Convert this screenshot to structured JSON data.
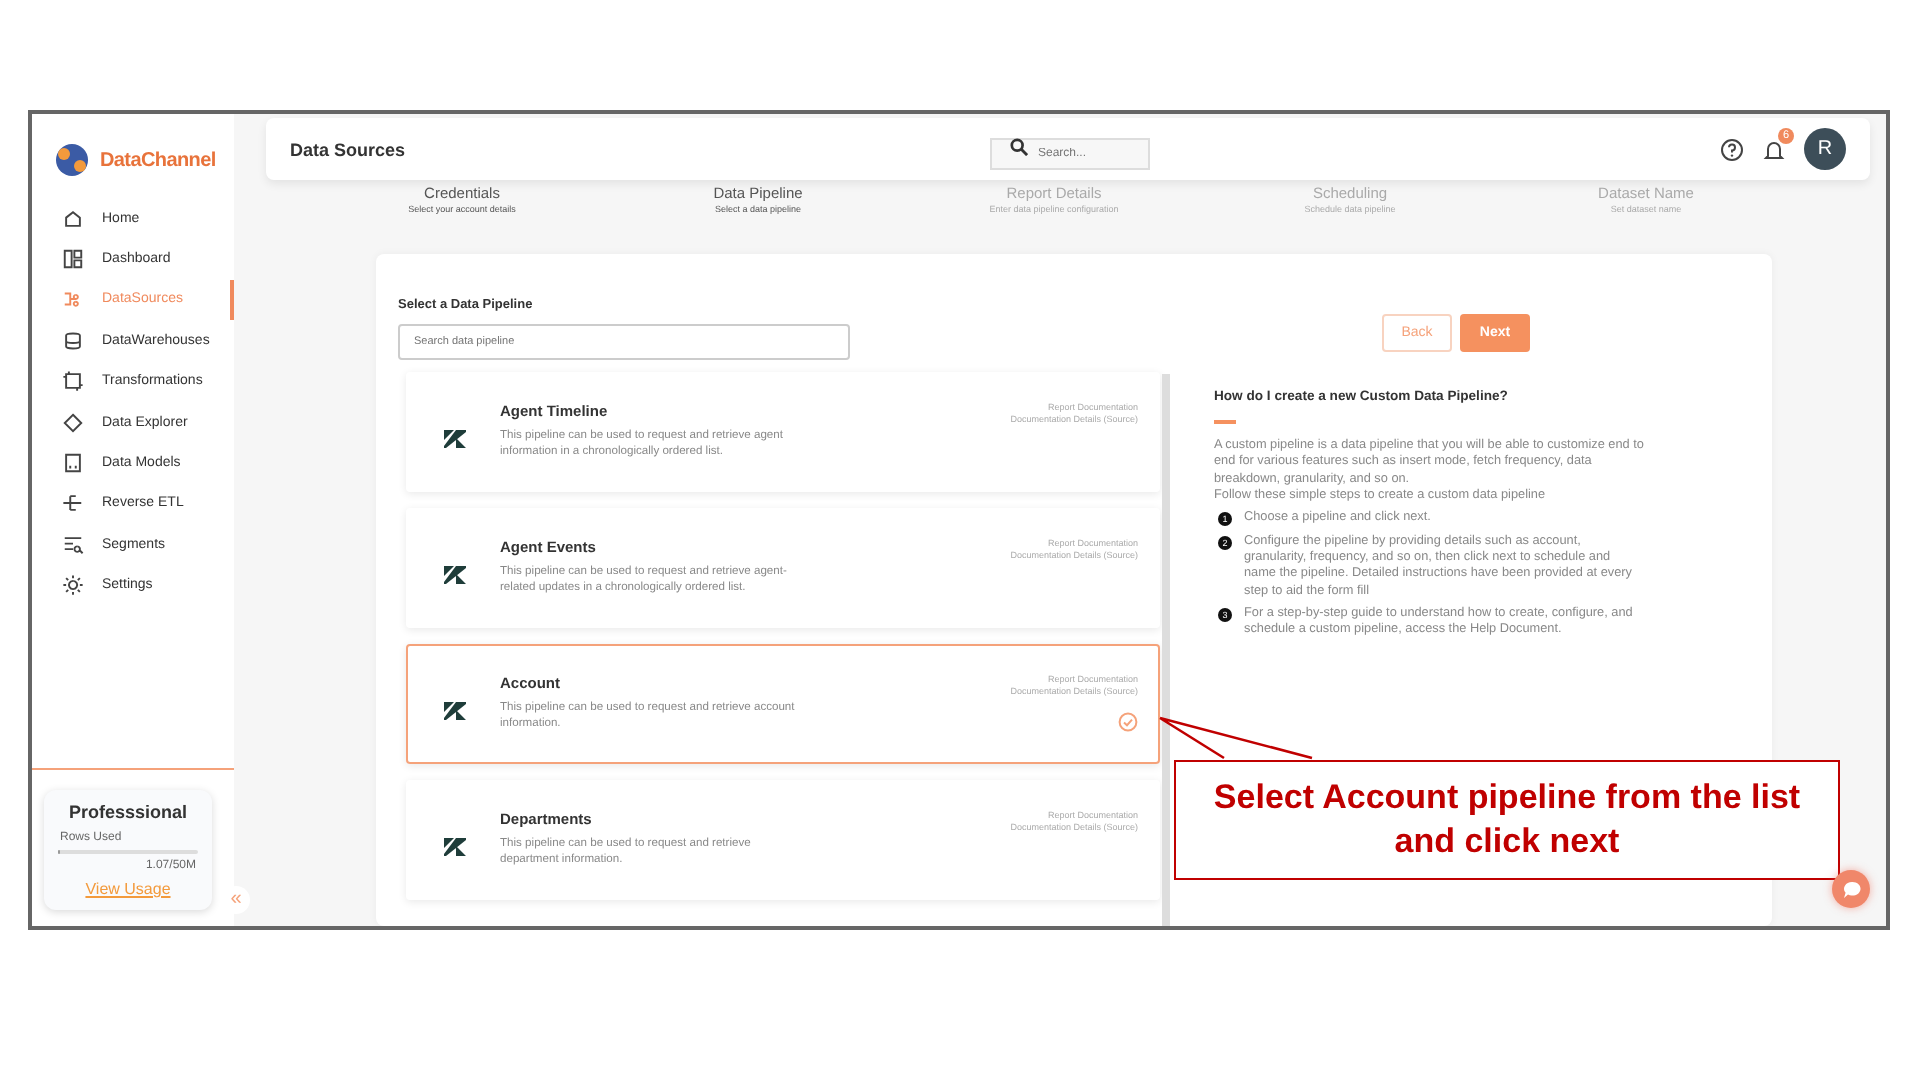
{
  "sidebar": {
    "brand": "DataChannel",
    "items": [
      {
        "label": "Home",
        "selected": false
      },
      {
        "label": "Dashboard",
        "selected": false
      },
      {
        "label": "DataSources",
        "selected": true
      },
      {
        "label": "DataWarehouses",
        "selected": false
      },
      {
        "label": "Transformations",
        "selected": false
      },
      {
        "label": "Data Explorer",
        "selected": false
      },
      {
        "label": "Data Models",
        "selected": false
      },
      {
        "label": "Reverse ETL",
        "selected": false
      },
      {
        "label": "Segments",
        "selected": false
      },
      {
        "label": "Settings",
        "selected": false
      }
    ],
    "plan": {
      "name": "Professsional",
      "usage_label": "Rows Used",
      "level": 0.02,
      "usage": "1.07/50M",
      "link": "View Usage"
    },
    "collapse": "«"
  },
  "header": {
    "title": "Data Sources",
    "search": {
      "placeholder": "Search..."
    },
    "notifications": "6",
    "avatar": "R"
  },
  "steps": [
    {
      "label": "Credentials",
      "sub": "Select your account details",
      "active": true
    },
    {
      "label": "Data Pipeline",
      "sub": "Select a data pipeline",
      "active": true
    },
    {
      "label": "Report Details",
      "sub": "Enter data pipeline configuration",
      "active": false
    },
    {
      "label": "Scheduling",
      "sub": "Schedule data pipeline",
      "active": false
    },
    {
      "label": "Dataset Name",
      "sub": "Set dataset name",
      "active": false
    }
  ],
  "picker": {
    "label": "Select a Data Pipeline",
    "search": {
      "placeholder": "Search data pipeline"
    },
    "back": "Back",
    "next": "Next"
  },
  "pipelines": [
    {
      "name": "Agent Timeline",
      "description": "This pipeline can be used to request and retrieve agent information in a chronologically ordered list.",
      "links": [
        "Report Documentation",
        "Documentation Details (Source)"
      ],
      "selected": false
    },
    {
      "name": "Agent Events",
      "description": "This pipeline can be used to request and retrieve agent-related updates in a chronologically ordered list.",
      "links": [
        "Report Documentation",
        "Documentation Details (Source)"
      ],
      "selected": false
    },
    {
      "name": "Account",
      "description": "This pipeline can be used to request and retrieve account information.",
      "links": [
        "Report Documentation",
        "Documentation Details (Source)"
      ],
      "selected": true
    },
    {
      "name": "Departments",
      "description": "This pipeline can be used to request and retrieve department information.",
      "links": [
        "Report Documentation",
        "Documentation Details (Source)"
      ],
      "selected": false
    }
  ],
  "help": {
    "title": "How do I create a new Custom Data Pipeline?",
    "intro": "A custom pipeline is a data pipeline that you will be able to customize end to end for various features such as insert mode, fetch frequency, data breakdown, granularity, and so on.",
    "lead": "Follow these simple steps to create a custom data pipeline",
    "steps": [
      {
        "number": "1",
        "text": "Choose a pipeline and click next."
      },
      {
        "number": "2",
        "text": "Configure the pipeline by providing details such as account, granularity, frequency, and so on, then click next to schedule and name the pipeline. Detailed instructions have been provided at every step to aid the form fill"
      },
      {
        "number": "3",
        "text": "For a step-by-step guide to understand how to create, configure, and schedule a custom pipeline, access the Help Document."
      }
    ]
  },
  "annotation": "Select Account pipeline from the list and click next"
}
